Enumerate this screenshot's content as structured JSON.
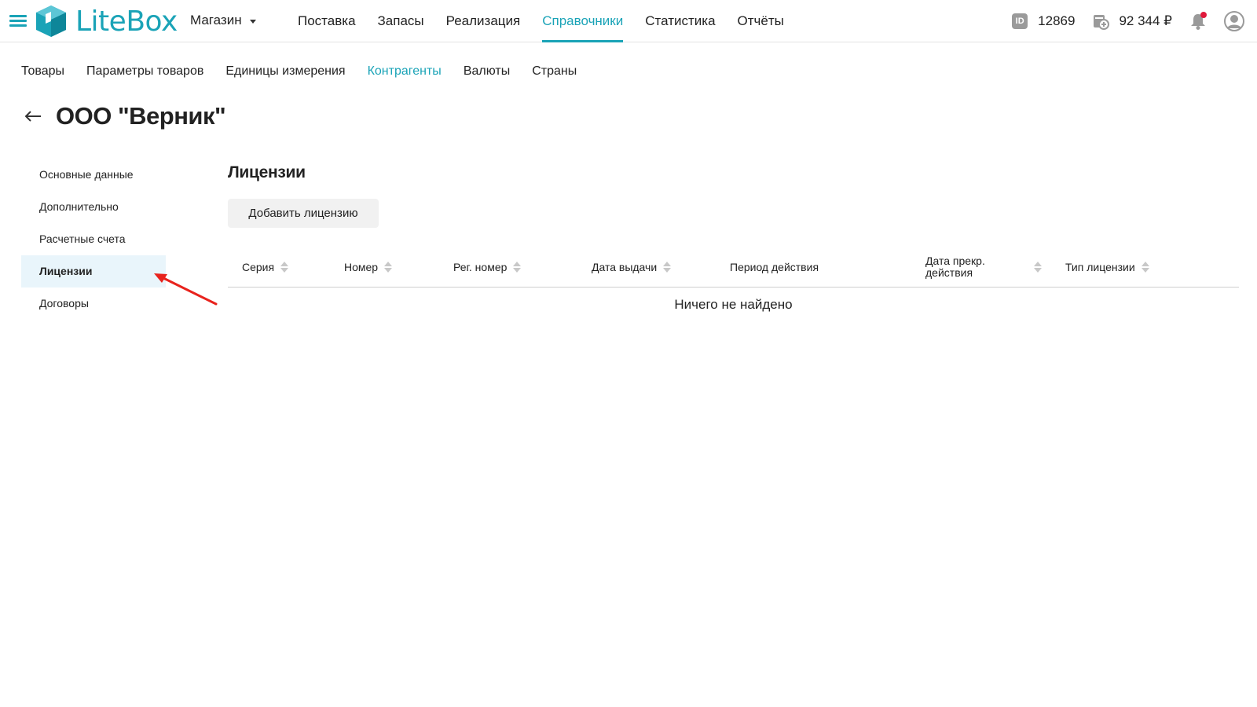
{
  "header": {
    "logo_text": "LiteBox",
    "store_label": "Магазин",
    "nav": [
      "Поставка",
      "Запасы",
      "Реализация",
      "Справочники",
      "Статистика",
      "Отчёты"
    ],
    "active_nav": "Справочники",
    "id_badge": "ID",
    "account_id": "12869",
    "balance": "92 344 ₽",
    "accent_color": "#1aa3b7",
    "notification_dot_color": "#e0193b"
  },
  "subnav": {
    "items": [
      "Товары",
      "Параметры товаров",
      "Единицы измерения",
      "Контрагенты",
      "Валюты",
      "Страны"
    ],
    "active": "Контрагенты"
  },
  "page": {
    "title": "ООО \"Верник\""
  },
  "sidemenu": {
    "items": [
      "Основные данные",
      "Дополнительно",
      "Расчетные счета",
      "Лицензии",
      "Договоры"
    ],
    "active": "Лицензии"
  },
  "content": {
    "section_title": "Лицензии",
    "add_button": "Добавить лицензию",
    "columns": [
      "Серия",
      "Номер",
      "Рег. номер",
      "Дата выдачи",
      "Период действия",
      "Дата прекр. действия",
      "Тип лицензии"
    ],
    "empty_message": "Ничего не найдено"
  }
}
